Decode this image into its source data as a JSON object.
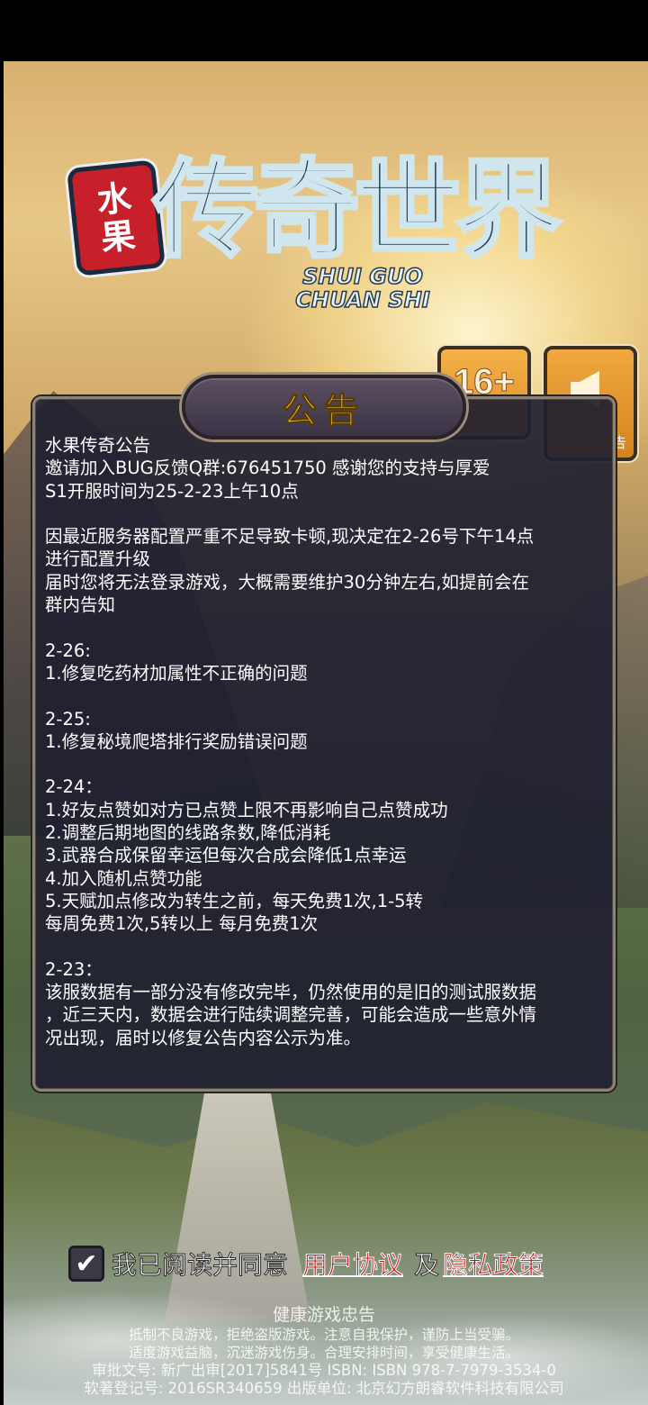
{
  "logo": {
    "badge": [
      "水",
      "果"
    ],
    "title": "传奇世界",
    "en_line1": "SHUI GUO",
    "en_line2": "CHUAN SHI"
  },
  "rating": {
    "label": "16+"
  },
  "side_button": {
    "label": "告",
    "icon": "megaphone-icon"
  },
  "notice": {
    "title": "公告",
    "lines": [
      "水果传奇公告",
      "邀请加入BUG反馈Q群:676451750 感谢您的支持与厚爱",
      "S1开服时间为25-2-23上午10点",
      "",
      "因最近服务器配置严重不足导致卡顿,现决定在2-26号下午14点",
      "进行配置升级",
      "届时您将无法登录游戏，大概需要维护30分钟左右,如提前会在",
      "群内告知",
      "",
      "2-26:",
      "1.修复吃药材加属性不正确的问题",
      "",
      "2-25:",
      "1.修复秘境爬塔排行奖励错误问题",
      "",
      "2-24：",
      "1.好友点赞如对方已点赞上限不再影响自己点赞成功",
      "2.调整后期地图的线路条数,降低消耗",
      "3.武器合成保留幸运但每次合成会降低1点幸运",
      "4.加入随机点赞功能",
      "5.天赋加点修改为转生之前，每天免费1次,1-5转",
      "每周免费1次,5转以上  每月免费1次",
      "",
      "2-23：",
      "该服数据有一部分没有修改完毕，仍然使用的是旧的测试服数据",
      "，近三天内，数据会进行陆续调整完善，可能会造成一些意外情",
      "况出现，届时以修复公告内容公示为准。"
    ]
  },
  "agreement": {
    "checked": true,
    "check_glyph": "✔",
    "text": "我已阅读并同意",
    "user_agreement": "用户协议",
    "and": "及",
    "privacy_policy": "隐私政策"
  },
  "advisory": {
    "heading": "健康游戏忠告",
    "line1": "抵制不良游戏，拒绝盗版游戏。注意自我保护，谨防上当受骗。",
    "line2": "适度游戏益脑，沉迷游戏伤身。合理安排时间，享受健康生活。",
    "line3": "审批文号: 新广出审[2017]5841号 ISBN: ISBN 978-7-7979-3534-0",
    "line4": "软著登记号: 2016SR340659 出版单位: 北京幻方朗睿软件科技有限公司"
  },
  "colors": {
    "title_gold": "#ffd735",
    "link_red": "#c3101a",
    "panel_bg": "#1f1f30"
  }
}
